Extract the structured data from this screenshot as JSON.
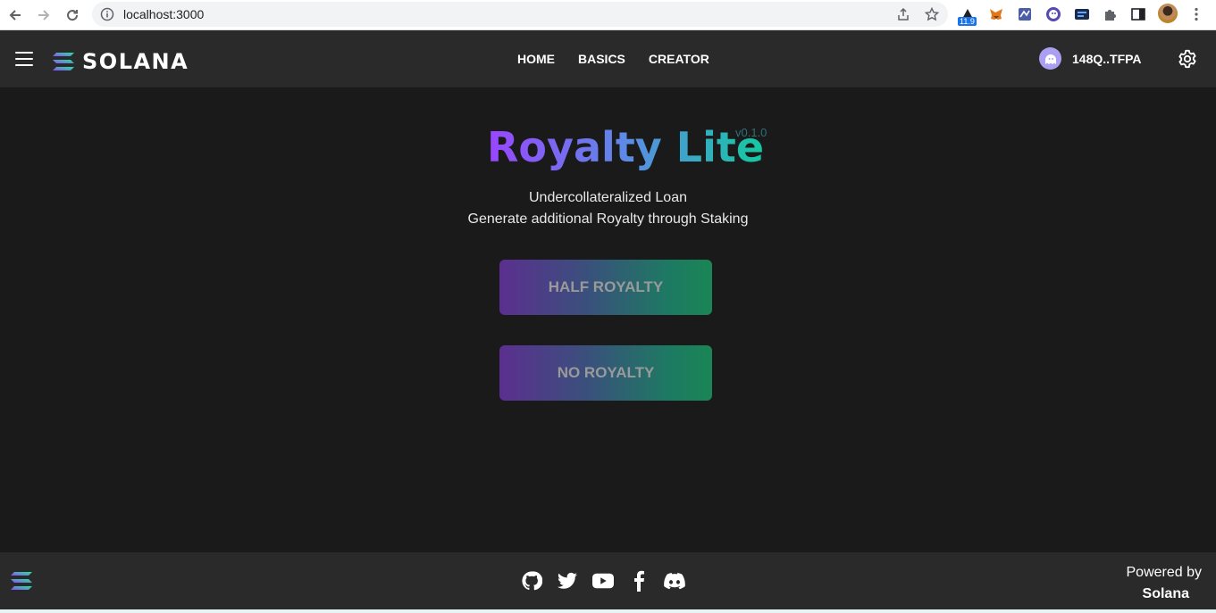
{
  "browser": {
    "url": "localhost:3000",
    "extension_badge": "11.9"
  },
  "header": {
    "brand": "SOLANA",
    "nav": [
      "HOME",
      "BASICS",
      "CREATOR"
    ],
    "wallet_address": "148Q..TFPA"
  },
  "main": {
    "title": "Royalty Lite",
    "version": "v0.1.0",
    "subtitle_line1": "Undercollateralized Loan",
    "subtitle_line2": "Generate additional Royalty through Staking",
    "buttons": {
      "half_royalty": "HALF ROYALTY",
      "no_royalty": "NO ROYALTY"
    }
  },
  "footer": {
    "socials": [
      "github-icon",
      "twitter-icon",
      "youtube-icon",
      "facebook-icon",
      "discord-icon"
    ],
    "powered_by": "Powered by",
    "powered_brand": "Solana"
  },
  "colors": {
    "accent_purple": "#9945ff",
    "accent_green": "#14f195",
    "background": "#1a1a1a",
    "bar": "#2a2a2a"
  }
}
